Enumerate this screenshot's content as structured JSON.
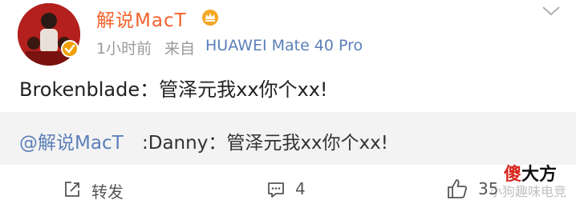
{
  "post": {
    "user_name": "解说MacT",
    "time": "1小时前",
    "source_prefix": "来自",
    "device": "HUAWEI Mate 40 Pro",
    "text": "Brokenblade：管泽元我xx你个xx!",
    "repost": {
      "mention": "@解说MacT",
      "text": ":Danny：管泽元我xx你个xx!"
    }
  },
  "actions": {
    "repost_label": "转发",
    "comment_count": "4",
    "like_count": "35"
  },
  "watermark": {
    "first_char": "傻",
    "rest": "大方",
    "sub": "小狗趣味电竞"
  },
  "icons": {
    "vip": "crown-badge-icon",
    "chevron": "chevron-down-icon",
    "repost": "share-icon",
    "comment": "comment-icon",
    "like": "thumbs-up-icon"
  },
  "colors": {
    "username": "#f2632c",
    "link": "#5b7fb8",
    "meta": "#9a9a9a",
    "repost_bg": "#f3f3f3"
  }
}
